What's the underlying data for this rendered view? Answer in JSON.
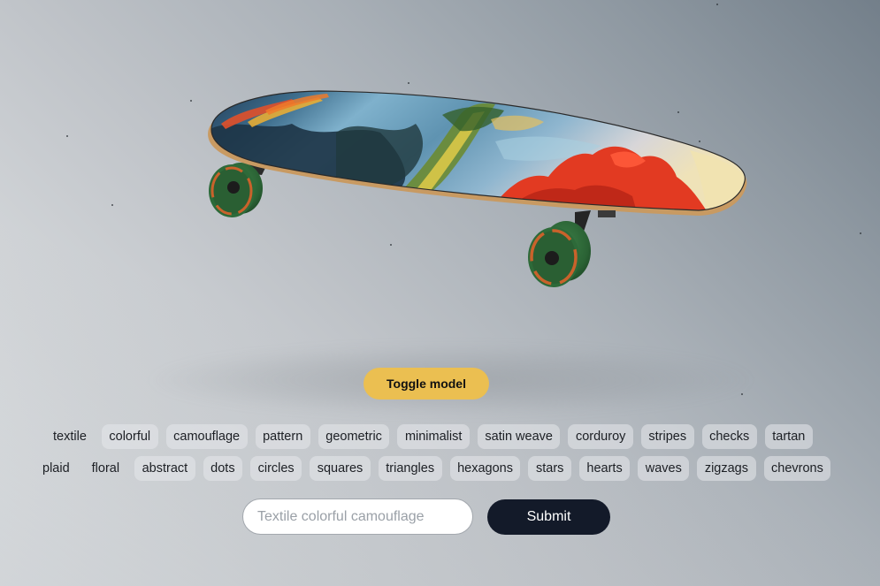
{
  "viewer": {
    "model_name": "skateboard",
    "deck_artwork": "painted landscape with blue sky, green and yellow foliage, red trees",
    "colors": {
      "wheel": "#2f6b3a",
      "deck_edge": "#c89a62",
      "truck": "#2b2b2b"
    }
  },
  "toggle_button": {
    "label": "Toggle model",
    "color": "#ebbf51"
  },
  "tags": {
    "row1": [
      "textile",
      "colorful",
      "camouflage",
      "pattern",
      "geometric",
      "minimalist",
      "satin weave",
      "corduroy",
      "stripes",
      "checks",
      "tartan"
    ],
    "row2": [
      "plaid",
      "floral",
      "abstract",
      "dots",
      "circles",
      "squares",
      "triangles",
      "hexagons",
      "stars",
      "hearts",
      "waves",
      "zigzags",
      "chevrons"
    ]
  },
  "prompt": {
    "value": "",
    "placeholder": "Textile colorful camouflage"
  },
  "submit_button": {
    "label": "Submit",
    "color": "#131a29"
  }
}
